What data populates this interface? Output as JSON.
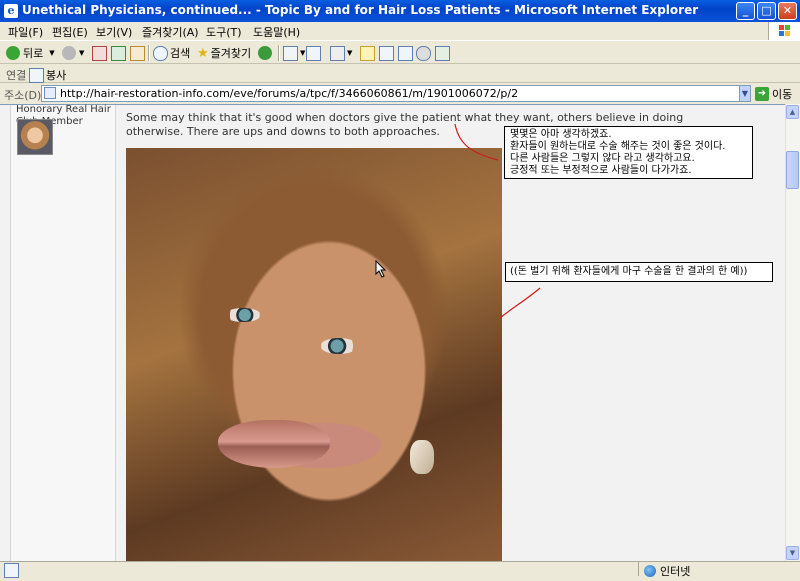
{
  "window": {
    "title": "Unethical Physicians, continued... - Topic By and for Hair Loss Patients - Microsoft Internet Explorer",
    "minimize": "_",
    "maximize": "□",
    "close": "✕"
  },
  "menu": [
    "파일(F)",
    "편집(E)",
    "보기(V)",
    "즐겨찾기(A)",
    "도구(T)",
    "도움말(H)"
  ],
  "toolbar": {
    "back_label": "뒤로",
    "search_label": "검색",
    "favorites_label": "즐겨찾기"
  },
  "links": {
    "label": "연결",
    "item": "봉사"
  },
  "address": {
    "label": "주소(D)",
    "url": "http://hair-restoration-info.com/eve/forums/a/tpc/f/3466060861/m/1901006072/p/2",
    "go_label": "이동"
  },
  "post": {
    "member_rank": "Honorary Real Hair Club Member",
    "text": "Some may think that it's good when doctors give the patient what they want, others believe in doing otherwise. There are ups and downs to both approaches."
  },
  "annotations": {
    "note1": [
      "몇몇은 아마 생각하겠죠.",
      "환자들이 원하는대로 수술 해주는 것이 좋은 것이다.",
      "다른 사람들은 그렇지 않다 라고 생각하고요.",
      "긍정적 또는 부정적으로 사람들이 다가가죠."
    ],
    "note2": "((돈 벌기 위해 환자들에게 마구 수술을 한 결과의 한 예))"
  },
  "status": {
    "zone": "인터넷"
  },
  "colors": {
    "titlebar": "#0a5ee0",
    "annotation_stroke": "#d11a1a"
  }
}
